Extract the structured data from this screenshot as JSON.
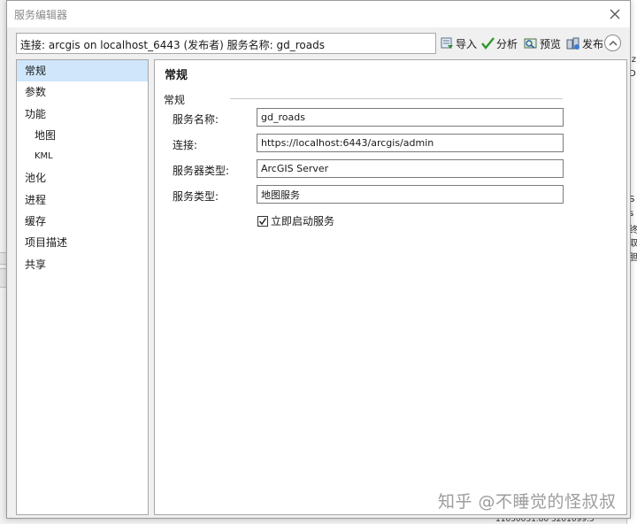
{
  "window": {
    "title": "服务编辑器"
  },
  "toolbar": {
    "connection_text": "连接: arcgis on localhost_6443 (发布者)   服务名称: gd_roads",
    "import_label": "导入",
    "analyze_label": "分析",
    "preview_label": "预览",
    "publish_label": "发布"
  },
  "nav": {
    "items": [
      {
        "label": "常规"
      },
      {
        "label": "参数"
      },
      {
        "label": "功能"
      },
      {
        "label": "地图"
      },
      {
        "label": "KML"
      },
      {
        "label": "池化"
      },
      {
        "label": "进程"
      },
      {
        "label": "缓存"
      },
      {
        "label": "项目描述"
      },
      {
        "label": "共享"
      }
    ]
  },
  "panel": {
    "title": "常规",
    "section": "常规",
    "fields": [
      {
        "label": "服务名称:",
        "value": "gd_roads"
      },
      {
        "label": "连接:",
        "value": "https://localhost:6443/arcgis/admin"
      },
      {
        "label": "服务器类型:",
        "value": "ArcGIS Server"
      },
      {
        "label": "服务类型:",
        "value": "地图服务"
      }
    ],
    "start_service": {
      "label": "立即启动服务",
      "checked": true
    }
  },
  "background": {
    "fragments": [
      "iz",
      "D",
      "S",
      "s",
      "终",
      "取",
      "胆"
    ],
    "status": "11030031.80  3201099.5"
  },
  "watermark": "知乎 @不睡觉的怪叔叔"
}
